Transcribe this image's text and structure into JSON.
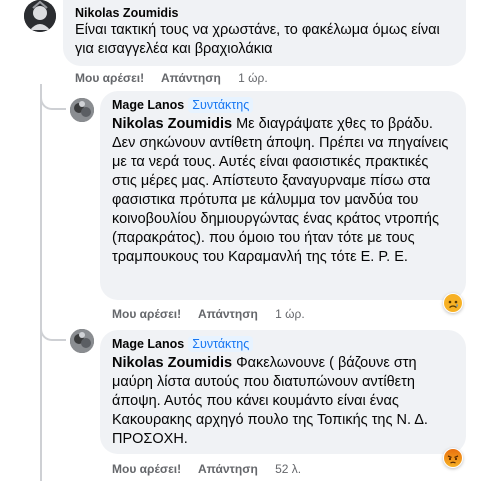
{
  "comment1": {
    "author": "Nikolas Zoumidis",
    "text": "Είναι τακτική τους να χρωστάνε, το φακέλωμα όμως είναι για εισαγγελέα και βραχιολάκια",
    "like": "Μου αρέσει!",
    "reply": "Απάντηση",
    "time": "1 ώρ."
  },
  "reply1": {
    "author": "Mage Lanos",
    "badge": "Συντάκτης",
    "mention": "Nikolas Zoumidis",
    "text": " Με διαγράψατε χθες το βράδυ. Δεν σηκώνουν αντίθετη άποψη. Πρέπει να πηγαίνεις με τα νερά τους. Αυτές είναι φασιστικές πρακτικές στις μέρες μας. Απίστευτο ξαναγυρναμε πίσω στα φασιστικα πρότυπα με κάλυμμα τον μανδύα του κοινοβουλίου δημιουργώντας ένας κράτος ντροπής (παρακράτος). που όμοιο του ήταν τότε με τους τραμπουκους του Καραμανλή της τότε Ε. Ρ. Ε.",
    "like": "Μου αρέσει!",
    "reply": "Απάντηση",
    "time": "1 ώρ.",
    "reaction_icon": "sad-face-icon"
  },
  "reply2": {
    "author": "Mage Lanos",
    "badge": "Συντάκτης",
    "mention": "Nikolas Zoumidis",
    "text": " Φακελωνουνε ( βάζουνε στη μαύρη λίστα αυτούς που διατυπώνουν αντίθετη άποψη. Αυτός που κάνει κουμάντο είναι ένας Κακουρακης αρχηγό πουλο της Τοπικής της Ν. Δ. ΠΡΟΣΟΧΗ.",
    "like": "Μου αρέσει!",
    "reply": "Απάντηση",
    "time": "52 λ.",
    "reaction_icon": "angry-face-icon"
  },
  "colors": {
    "bubble": "#f0f2f5",
    "badge_bg": "#e7f3ff",
    "badge_text": "#1877f2",
    "meta": "#65676b"
  }
}
